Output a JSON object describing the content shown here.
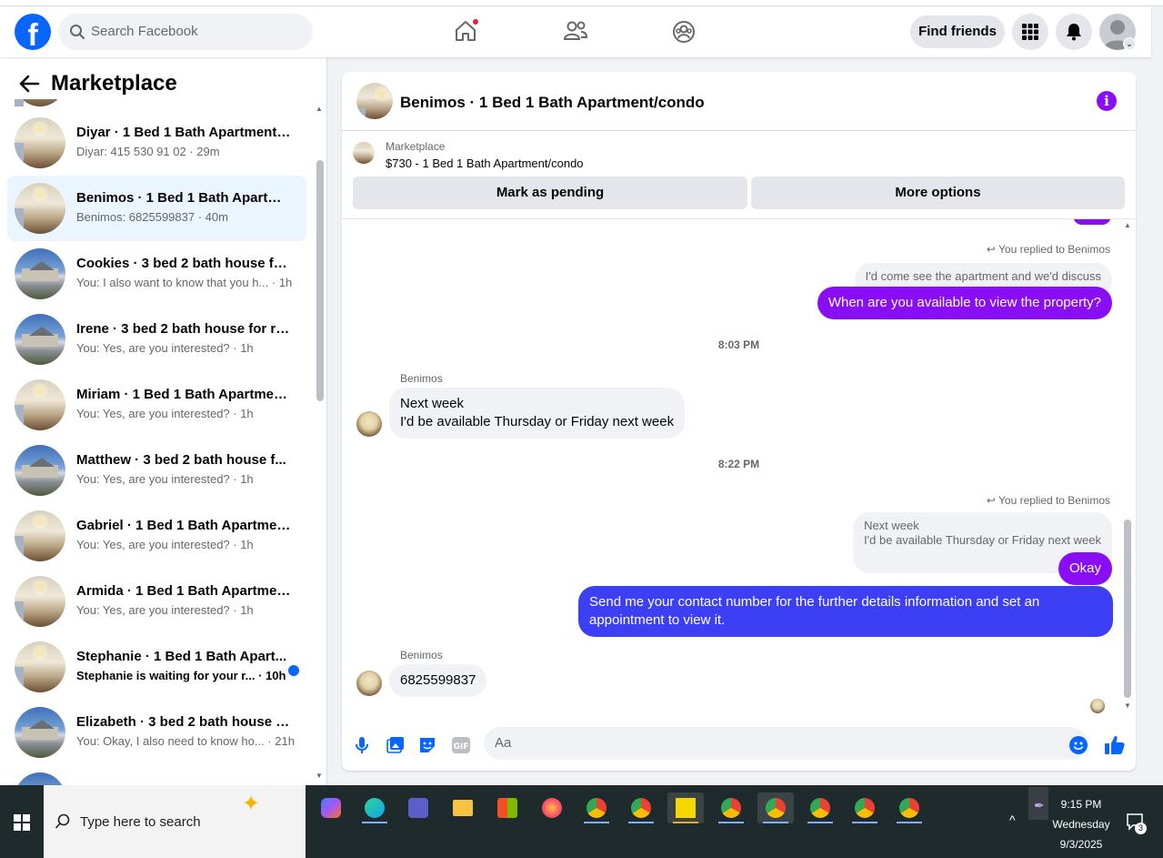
{
  "header": {
    "search_placeholder": "Search Facebook",
    "find_friends": "Find friends"
  },
  "sidebar": {
    "title": "Marketplace",
    "conversations": [
      {
        "name": "Diyar · 1 Bed 1 Bath Apartment/c...",
        "preview": "Diyar: 415 530 91 02 · 29m",
        "thumb": "apartment",
        "active": false,
        "unread": false
      },
      {
        "name": "Benimos · 1 Bed 1 Bath Apartme...",
        "preview": "Benimos: 6825599837 · 40m",
        "thumb": "apartment",
        "active": true,
        "unread": false
      },
      {
        "name": "Cookies · 3 bed 2 bath house for...",
        "preview": "You: I also want to know that you h... · 1h",
        "thumb": "house",
        "active": false,
        "unread": false
      },
      {
        "name": "Irene · 3 bed 2 bath house for rent",
        "preview": "You: Yes, are you interested? · 1h",
        "thumb": "house",
        "active": false,
        "unread": false
      },
      {
        "name": "Miriam · 1 Bed 1 Bath Apartment...",
        "preview": "You: Yes, are you interested? · 1h",
        "thumb": "apartment",
        "active": false,
        "unread": false
      },
      {
        "name": "Matthew · 3 bed 2 bath house f...",
        "preview": "You: Yes, are you interested? · 1h",
        "thumb": "house",
        "active": false,
        "unread": false
      },
      {
        "name": "Gabriel · 1 Bed 1 Bath Apartment...",
        "preview": "You: Yes, are you interested? · 1h",
        "thumb": "apartment",
        "active": false,
        "unread": false
      },
      {
        "name": "Armida · 1 Bed 1 Bath Apartmen...",
        "preview": "You: Yes, are you interested? · 1h",
        "thumb": "apartment",
        "active": false,
        "unread": false
      },
      {
        "name": "Stephanie · 1 Bed 1 Bath Apart...",
        "preview": "Stephanie is waiting for your r... · 10h",
        "thumb": "apartment",
        "active": false,
        "unread": true
      },
      {
        "name": "Elizabeth · 3 bed 2 bath house f...",
        "preview": "You: Okay, I also need to know ho... · 21h",
        "thumb": "house",
        "active": false,
        "unread": false
      }
    ]
  },
  "chat": {
    "title": "Benimos · 1 Bed 1 Bath Apartment/condo",
    "listing_source": "Marketplace",
    "listing_title": "$730 - 1 Bed 1 Bath Apartment/condo",
    "mark_pending": "Mark as pending",
    "more_options": "More options",
    "replied_label_1": "You replied to Benimos",
    "quoted_1": "I'd come see the apartment and we'd discuss",
    "out_1": "When are you available to view the property?",
    "time_1": "8:03 PM",
    "sender_1": "Benimos",
    "in_1_line1": "Next week",
    "in_1_line2": "I'd be available Thursday or Friday next week",
    "time_2": "8:22 PM",
    "replied_label_2": "You replied to Benimos",
    "quoted_2_line1": "Next week",
    "quoted_2_line2": "I'd be available Thursday or Friday next week",
    "out_2": "Okay",
    "out_3": "Send me your contact number for the further details information and set an appointment to view it.",
    "sender_2": "Benimos",
    "in_2": "6825599837",
    "composer_placeholder": "Aa"
  },
  "taskbar": {
    "search_placeholder": "Type here to search",
    "time": "9:15 PM",
    "day": "Wednesday",
    "date": "9/3/2025",
    "notification_count": "3"
  },
  "colors": {
    "fb_blue": "#0866ff",
    "messenger_purple": "#8a0ef5",
    "outgoing_blue": "#3d3ff5"
  }
}
